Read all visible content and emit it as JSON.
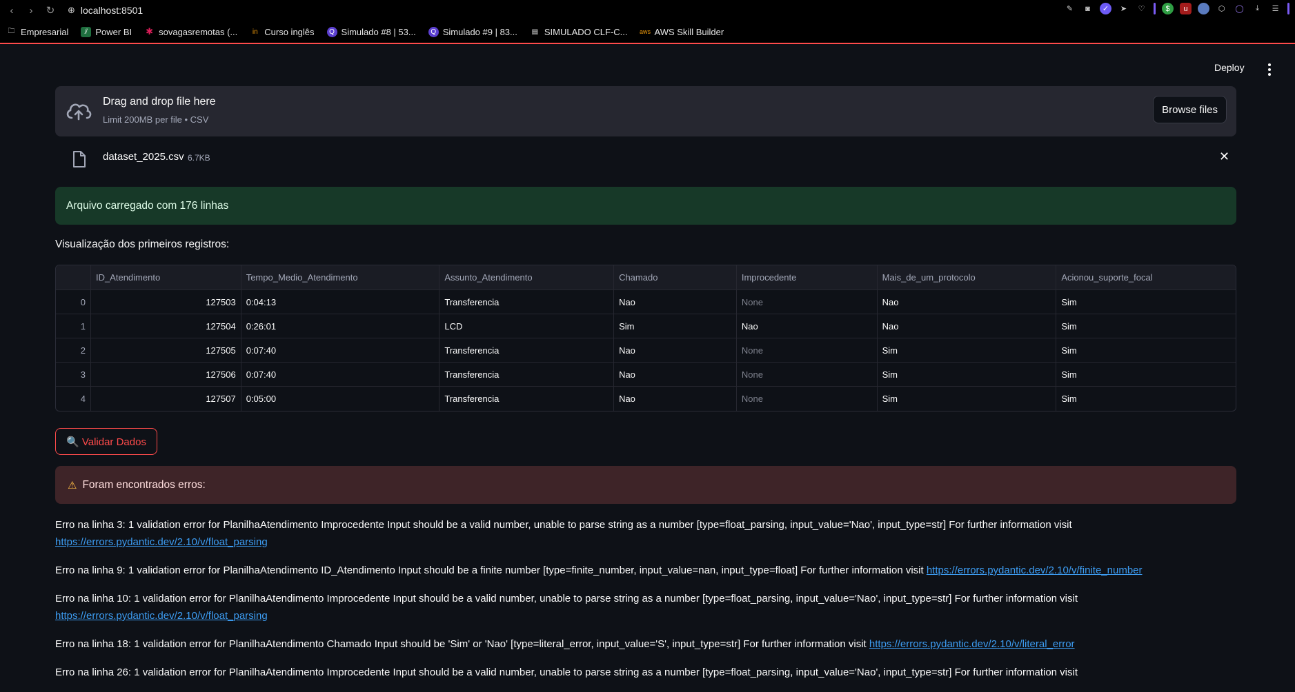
{
  "browser": {
    "url": "localhost:8501",
    "bookmarks": [
      {
        "label": "Empresarial",
        "icon": "folder-icon"
      },
      {
        "label": "Power BI",
        "icon": "powerbi-icon"
      },
      {
        "label": "sovagasremotas (...",
        "icon": "slack-icon"
      },
      {
        "label": "Curso inglês",
        "icon": "in-icon"
      },
      {
        "label": "Simulado #8 | 53...",
        "icon": "q-icon"
      },
      {
        "label": "Simulado #9 | 83...",
        "icon": "q-icon"
      },
      {
        "label": "SIMULADO CLF-C...",
        "icon": "document-icon"
      },
      {
        "label": "AWS Skill Builder",
        "icon": "aws-icon"
      }
    ]
  },
  "header": {
    "deploy_label": "Deploy"
  },
  "uploader": {
    "title": "Drag and drop file here",
    "subtitle": "Limit 200MB per file • CSV",
    "browse_label": "Browse files"
  },
  "file": {
    "name": "dataset_2025.csv",
    "size": "6.7KB"
  },
  "success_message": "Arquivo carregado com 176 linhas",
  "preview_label": "Visualização dos primeiros registros:",
  "table": {
    "columns": [
      "",
      "ID_Atendimento",
      "Tempo_Medio_Atendimento",
      "Assunto_Atendimento",
      "Chamado",
      "Improcedente",
      "Mais_de_um_protocolo",
      "Acionou_suporte_focal"
    ],
    "rows": [
      [
        "0",
        "127503",
        "0:04:13",
        "Transferencia",
        "Nao",
        "None",
        "Nao",
        "Sim"
      ],
      [
        "1",
        "127504",
        "0:26:01",
        "LCD",
        "Sim",
        "Nao",
        "Nao",
        "Sim"
      ],
      [
        "2",
        "127505",
        "0:07:40",
        "Transferencia",
        "Nao",
        "None",
        "Sim",
        "Sim"
      ],
      [
        "3",
        "127506",
        "0:07:40",
        "Transferencia",
        "Nao",
        "None",
        "Sim",
        "Sim"
      ],
      [
        "4",
        "127507",
        "0:05:00",
        "Transferencia",
        "Nao",
        "None",
        "Sim",
        "Sim"
      ]
    ]
  },
  "validate_label": "🔍 Validar Dados",
  "error_title": "Foram encontrados erros:",
  "errors": [
    {
      "text": "Erro na linha 3: 1 validation error for PlanilhaAtendimento Improcedente Input should be a valid number, unable to parse string as a number [type=float_parsing, input_value='Nao', input_type=str] For further information visit ",
      "link": "https://errors.pydantic.dev/2.10/v/float_parsing"
    },
    {
      "text": "Erro na linha 9: 1 validation error for PlanilhaAtendimento ID_Atendimento Input should be a finite number [type=finite_number, input_value=nan, input_type=float] For further information visit ",
      "link": "https://errors.pydantic.dev/2.10/v/finite_number"
    },
    {
      "text": "Erro na linha 10: 1 validation error for PlanilhaAtendimento Improcedente Input should be a valid number, unable to parse string as a number [type=float_parsing, input_value='Nao', input_type=str] For further information visit ",
      "link": "https://errors.pydantic.dev/2.10/v/float_parsing"
    },
    {
      "text": "Erro na linha 18: 1 validation error for PlanilhaAtendimento Chamado Input should be 'Sim' or 'Nao' [type=literal_error, input_value='S', input_type=str] For further information visit ",
      "link": "https://errors.pydantic.dev/2.10/v/literal_error"
    },
    {
      "text": "Erro na linha 26: 1 validation error for PlanilhaAtendimento Improcedente Input should be a valid number, unable to parse string as a number [type=float_parsing, input_value='Nao', input_type=str] For further information visit ",
      "link": ""
    }
  ]
}
